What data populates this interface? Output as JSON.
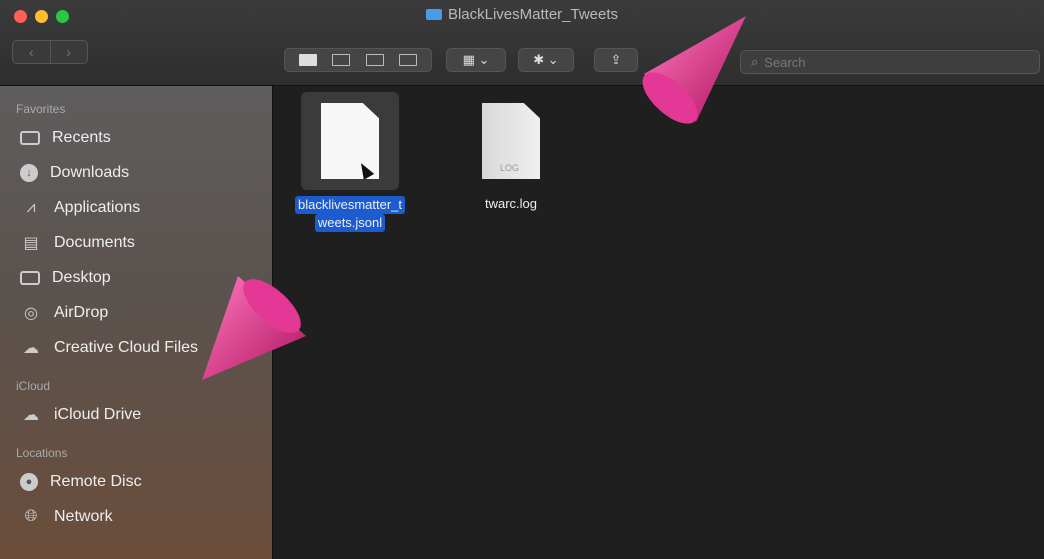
{
  "window": {
    "title": "BlackLivesMatter_Tweets"
  },
  "toolbar": {
    "back_label": "‹",
    "forward_label": "›",
    "group_label": "▦ ⌄",
    "action_label": "✱ ⌄",
    "share_label": "⇪",
    "search_placeholder": "Search"
  },
  "sidebar": {
    "favorites_header": "Favorites",
    "favorites": [
      {
        "label": "Recents",
        "icon": "recents-icon"
      },
      {
        "label": "Downloads",
        "icon": "downloads-icon"
      },
      {
        "label": "Applications",
        "icon": "applications-icon"
      },
      {
        "label": "Documents",
        "icon": "documents-icon"
      },
      {
        "label": "Desktop",
        "icon": "desktop-icon"
      },
      {
        "label": "AirDrop",
        "icon": "airdrop-icon"
      },
      {
        "label": "Creative Cloud Files",
        "icon": "creative-cloud-icon"
      }
    ],
    "icloud_header": "iCloud",
    "icloud": [
      {
        "label": "iCloud Drive",
        "icon": "icloud-icon"
      }
    ],
    "locations_header": "Locations",
    "locations": [
      {
        "label": "Remote Disc",
        "icon": "disc-icon"
      },
      {
        "label": "Network",
        "icon": "network-icon"
      }
    ]
  },
  "files": [
    {
      "name_line1": "blacklivesmatter_t",
      "name_line2": "weets.jsonl",
      "selected": true
    },
    {
      "name": "twarc.log",
      "ext_label": "LOG",
      "selected": false
    }
  ],
  "colors": {
    "selection": "#1c5bd0",
    "cone": "#e0308c"
  }
}
